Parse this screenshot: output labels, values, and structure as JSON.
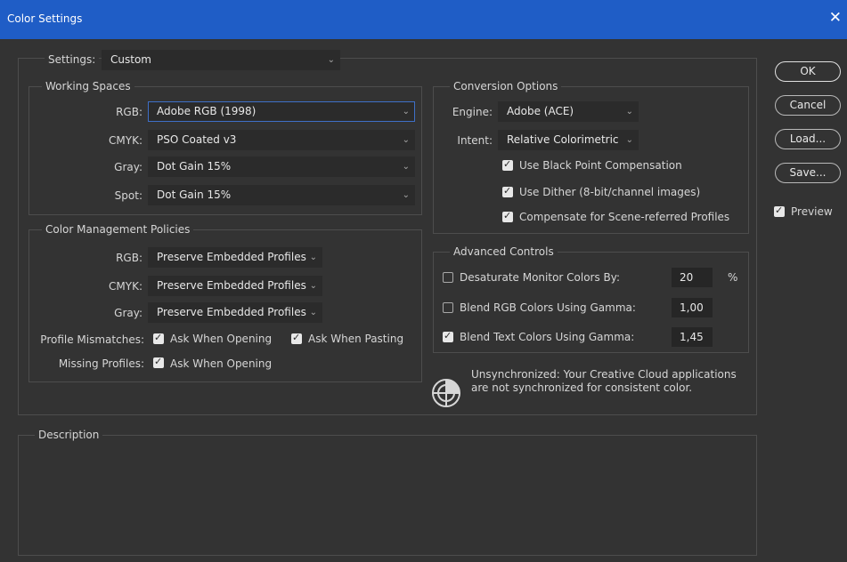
{
  "window": {
    "title": "Color Settings",
    "close_glyph": "✕"
  },
  "settings": {
    "label": "Settings:",
    "value": "Custom"
  },
  "working_spaces": {
    "title": "Working Spaces",
    "rows": [
      {
        "label": "RGB:",
        "value": "Adobe RGB (1998)"
      },
      {
        "label": "CMYK:",
        "value": "PSO Coated v3"
      },
      {
        "label": "Gray:",
        "value": "Dot Gain 15%"
      },
      {
        "label": "Spot:",
        "value": "Dot Gain 15%"
      }
    ]
  },
  "policies": {
    "title": "Color Management Policies",
    "rows": [
      {
        "label": "RGB:",
        "value": "Preserve Embedded Profiles"
      },
      {
        "label": "CMYK:",
        "value": "Preserve Embedded Profiles"
      },
      {
        "label": "Gray:",
        "value": "Preserve Embedded Profiles"
      }
    ],
    "mismatches_label": "Profile Mismatches:",
    "ask_opening": {
      "label": "Ask When Opening",
      "checked": true
    },
    "ask_pasting": {
      "label": "Ask When Pasting",
      "checked": true
    },
    "missing_label": "Missing Profiles:",
    "missing_ask_opening": {
      "label": "Ask When Opening",
      "checked": true
    }
  },
  "conversion": {
    "title": "Conversion Options",
    "engine_label": "Engine:",
    "engine_value": "Adobe (ACE)",
    "intent_label": "Intent:",
    "intent_value": "Relative Colorimetric",
    "black_point": {
      "label": "Use Black Point Compensation",
      "checked": true
    },
    "dither": {
      "label": "Use Dither (8-bit/channel images)",
      "checked": true
    },
    "scene_referred": {
      "label": "Compensate for Scene-referred Profiles",
      "checked": true
    }
  },
  "advanced": {
    "title": "Advanced Controls",
    "desaturate": {
      "label": "Desaturate Monitor Colors By:",
      "value": "20",
      "unit": "%",
      "checked": false
    },
    "blend_rgb": {
      "label": "Blend RGB Colors Using Gamma:",
      "value": "1,00",
      "checked": false
    },
    "blend_text": {
      "label": "Blend Text Colors Using Gamma:",
      "value": "1,45",
      "checked": true
    }
  },
  "sync": {
    "line1": "Unsynchronized: Your Creative Cloud applications",
    "line2": "are not synchronized for consistent color.",
    "icon": "sync-status-icon"
  },
  "description": {
    "title": "Description"
  },
  "buttons": {
    "ok": "OK",
    "cancel": "Cancel",
    "load": "Load...",
    "save": "Save..."
  },
  "preview": {
    "label": "Preview",
    "checked": true
  },
  "icons": {
    "chevron": "⌄",
    "check": "✓"
  },
  "colors": {
    "title_bar": "#1f5dc6",
    "dialog_bg": "#333333",
    "field_bg": "#2b2b2b",
    "focus_border": "#3e6fc7"
  }
}
